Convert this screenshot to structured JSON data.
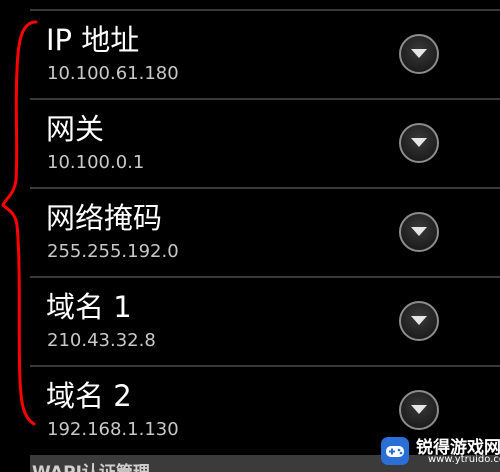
{
  "settings": {
    "rows": [
      {
        "label": "IP 地址",
        "value": "10.100.61.180",
        "icon": "chevron-down-icon"
      },
      {
        "label": "网关",
        "value": "10.100.0.1",
        "icon": "chevron-down-icon"
      },
      {
        "label": "网络掩码",
        "value": "255.255.192.0",
        "icon": "chevron-down-icon"
      },
      {
        "label": "域名 1",
        "value": "210.43.32.8",
        "icon": "chevron-down-icon"
      },
      {
        "label": "域名 2",
        "value": "192.168.1.130",
        "icon": "chevron-down-icon"
      }
    ],
    "next_section_title": "WAPI认证管理"
  },
  "annotation": {
    "color": "#ff0000",
    "shape": "curly-brace"
  },
  "watermark": {
    "title": "锐得游戏网",
    "url": "www.ytruido.com",
    "brand_color": "#2a6fd6"
  },
  "theme": {
    "background": "#000000",
    "label_color": "#ffffff",
    "value_color": "#c8c8c8",
    "divider_color": "#3a3a3a"
  }
}
